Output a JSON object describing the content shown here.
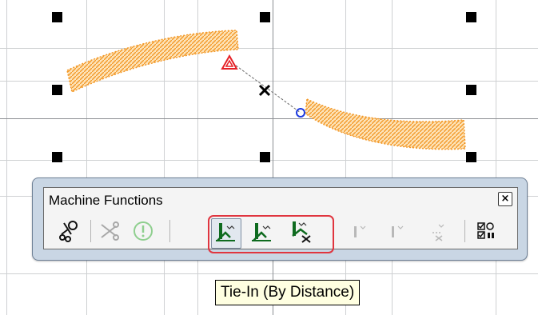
{
  "canvas": {
    "background": "#ffffff",
    "grid_color": "#ced0d2",
    "axis_color": "#8c8f93",
    "stitch_color": "#f39a2a"
  },
  "design": {
    "start_marker_icon": "triangle-start-marker-icon",
    "end_marker_icon": "circle-end-marker-icon",
    "center_icon": "x-cross-center-icon",
    "start_marker_color": "#e51f25",
    "end_marker_color": "#1d3be0"
  },
  "panel": {
    "title": "Machine Functions",
    "close_label": "×",
    "highlight_color": "#e0353f",
    "tools": [
      {
        "icon": "needle-scissors-icon",
        "enabled": true
      },
      {
        "icon": "scissors-icon",
        "enabled": false
      },
      {
        "icon": "stop-icon",
        "enabled": false
      },
      {
        "icon": "tie-in-by-distance-icon",
        "enabled": true,
        "active": true
      },
      {
        "icon": "tie-in-icon",
        "enabled": true
      },
      {
        "icon": "tie-off-icon",
        "enabled": true
      },
      {
        "icon": "tie-in-disabled-icon",
        "enabled": false
      },
      {
        "icon": "tie-in-alt-disabled-icon",
        "enabled": false
      },
      {
        "icon": "trim-disabled-icon",
        "enabled": false
      },
      {
        "icon": "checklist-settings-icon",
        "enabled": true
      }
    ]
  },
  "tooltip": {
    "text": "Tie-In (By Distance)"
  }
}
